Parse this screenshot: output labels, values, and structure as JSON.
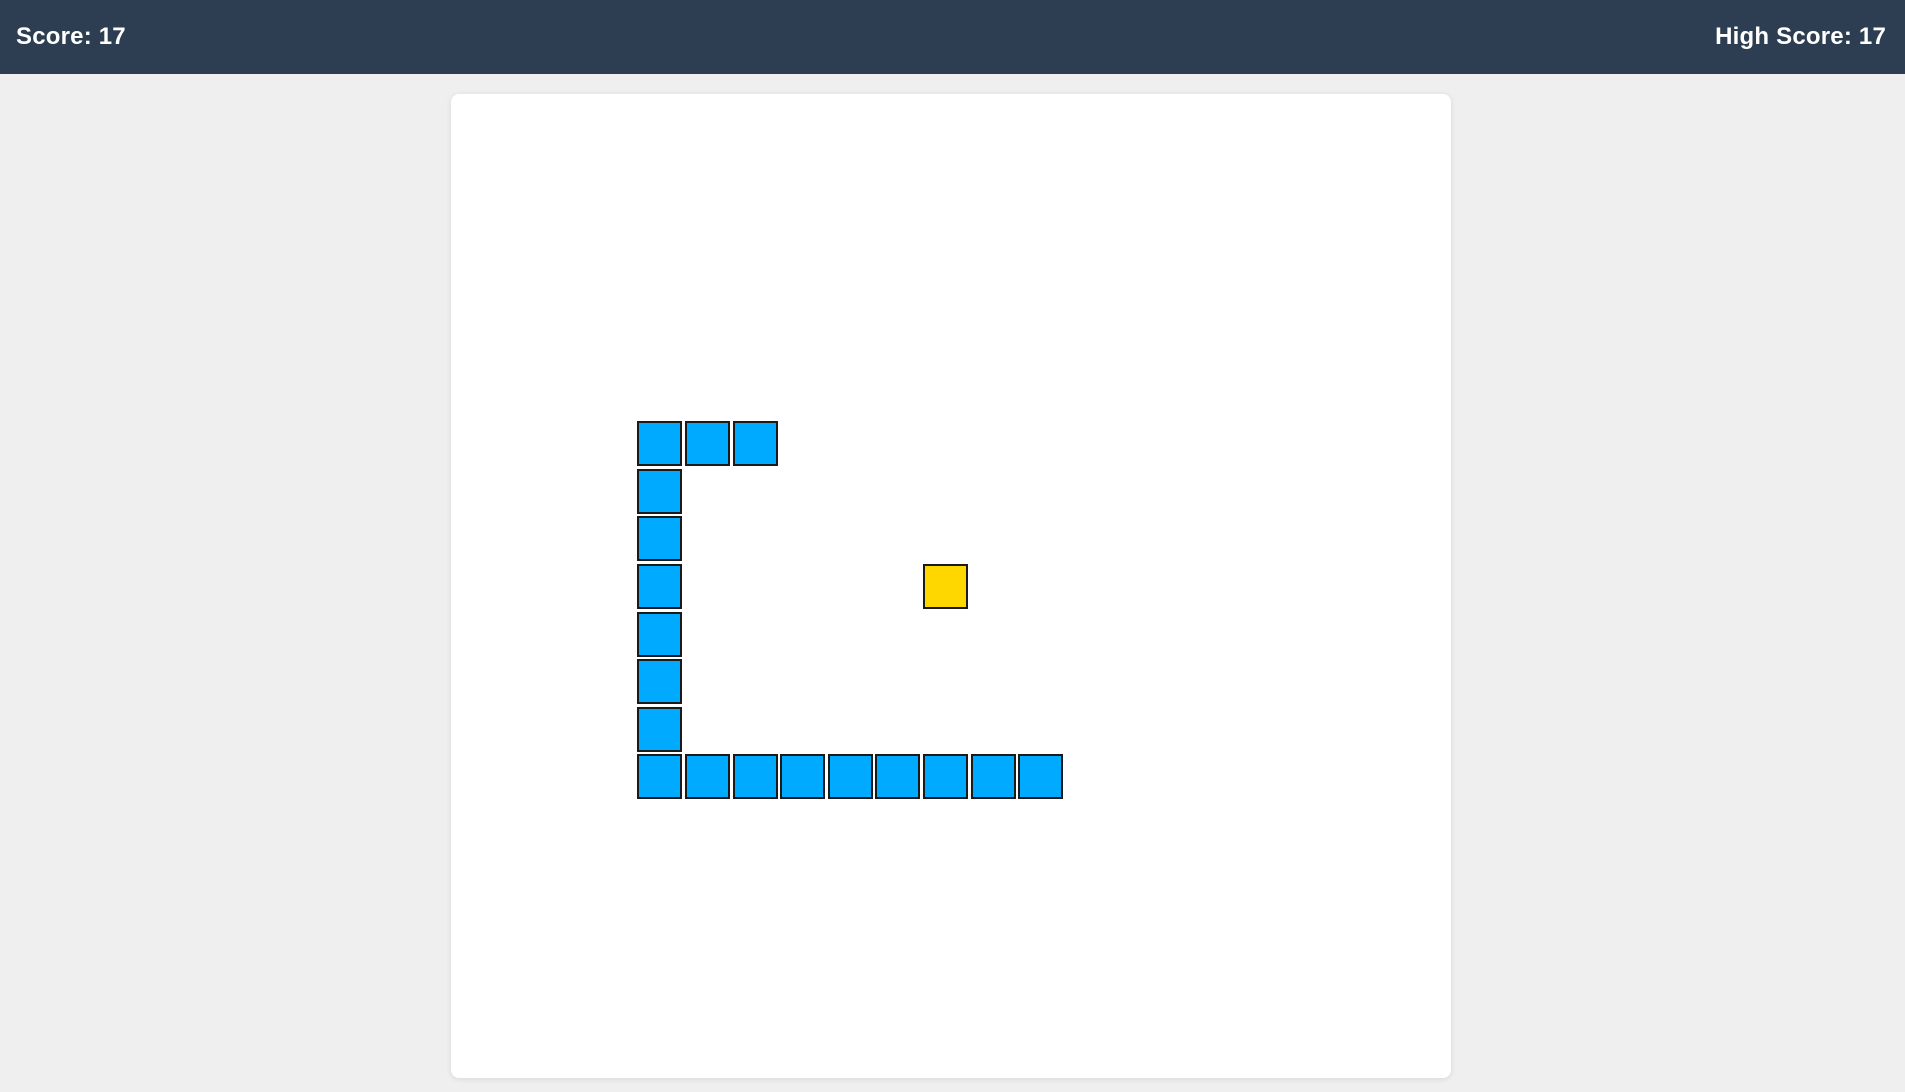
{
  "header": {
    "score_label": "Score: 17",
    "high_score_label": "High Score: 17"
  },
  "game": {
    "grid_columns": 21,
    "grid_rows": 21,
    "cell_units": "grid cells",
    "snake_color": "#00aaff",
    "food_color": "#ffd700",
    "snake": [
      [
        4,
        7
      ],
      [
        5,
        7
      ],
      [
        6,
        7
      ],
      [
        4,
        8
      ],
      [
        4,
        9
      ],
      [
        4,
        10
      ],
      [
        4,
        11
      ],
      [
        4,
        12
      ],
      [
        4,
        13
      ],
      [
        4,
        14
      ],
      [
        5,
        14
      ],
      [
        6,
        14
      ],
      [
        7,
        14
      ],
      [
        8,
        14
      ],
      [
        9,
        14
      ],
      [
        10,
        14
      ],
      [
        11,
        14
      ],
      [
        12,
        14
      ]
    ],
    "food": [
      10,
      10
    ]
  }
}
